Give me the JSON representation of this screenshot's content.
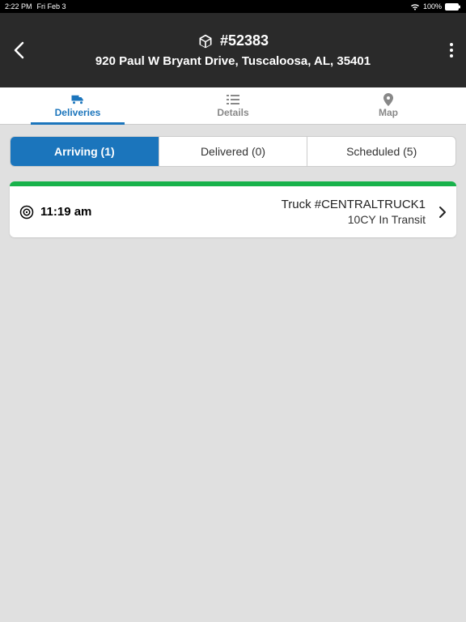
{
  "status": {
    "time": "2:22 PM",
    "date": "Fri Feb 3",
    "battery": "100%"
  },
  "header": {
    "order": "#52383",
    "address": "920 Paul W Bryant Drive, Tuscaloosa, AL, 35401"
  },
  "topTabs": {
    "deliveries": "Deliveries",
    "details": "Details",
    "map": "Map"
  },
  "segments": {
    "arriving": "Arriving (1)",
    "delivered": "Delivered (0)",
    "scheduled": "Scheduled (5)"
  },
  "card": {
    "time": "11:19 am",
    "truck": "Truck #CENTRALTRUCK1",
    "status": "10CY In Transit",
    "stripeColor": "#18b24b"
  },
  "colors": {
    "accent": "#1b75bc"
  }
}
